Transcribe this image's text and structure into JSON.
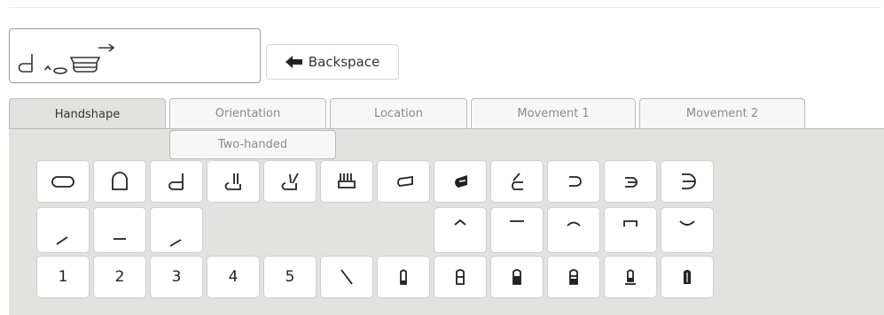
{
  "backspace": {
    "label": "Backspace",
    "icon": "arrow-left-icon"
  },
  "tabs": [
    {
      "label": "Handshape",
      "active": true
    },
    {
      "label": "Orientation"
    },
    {
      "label": "Location"
    },
    {
      "label": "Movement 1"
    },
    {
      "label": "Movement 2"
    },
    {
      "label": "Two-handed"
    }
  ],
  "display": {
    "symbols": [
      "flat-thumb-hand-symbol",
      "caret-symbol",
      "oval-symbol",
      "bent-fingers-symbol",
      "right-arrow-symbol"
    ]
  },
  "keyboard": {
    "row1": [
      "fist-oval",
      "fist-arch",
      "flat-thumb",
      "two-fingers",
      "bent-fingers",
      "five-fingers",
      "pointed-oval",
      "shaded-oval",
      "cupped-hand",
      "c-hand",
      "curved-e-hand",
      "claw-hand"
    ],
    "row2": [
      "slash-low",
      "dash-low",
      "slash-small",
      "",
      "",
      "",
      "",
      "caret",
      "macron",
      "arc",
      "bracket",
      "check"
    ],
    "row3_numbers": [
      "1",
      "2",
      "3",
      "4",
      "5"
    ],
    "row3_symbols": [
      "backslash",
      "narrow-bar",
      "open-bar",
      "filled-bar",
      "split-bar",
      "base-bar",
      "bold-bar"
    ]
  }
}
